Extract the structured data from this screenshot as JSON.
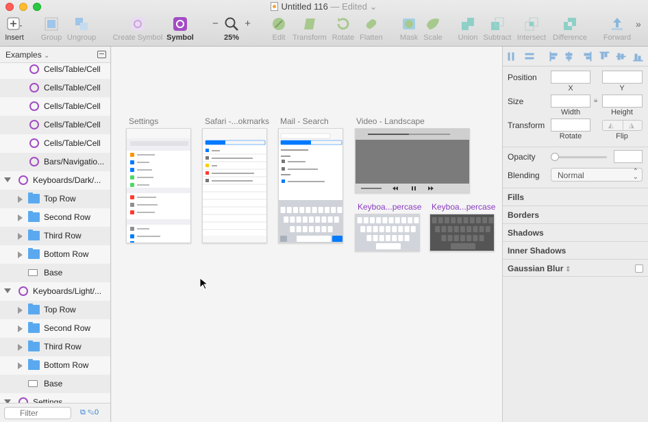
{
  "window": {
    "title": "Untitled 116",
    "status": "Edited"
  },
  "toolbar": [
    {
      "id": "insert",
      "label": "Insert",
      "icon": "plus-icon",
      "enabled": true
    },
    {
      "id": "group",
      "label": "Group",
      "icon": "group-icon",
      "enabled": false
    },
    {
      "id": "ungroup",
      "label": "Ungroup",
      "icon": "ungroup-icon",
      "enabled": false
    },
    {
      "id": "create-symbol",
      "label": "Create Symbol",
      "icon": "create-symbol-icon",
      "enabled": false
    },
    {
      "id": "symbol",
      "label": "Symbol",
      "icon": "symbol-icon",
      "enabled": true
    },
    {
      "id": "zoom",
      "label": "25%",
      "icon": "magnifier-icon",
      "enabled": true
    },
    {
      "id": "edit",
      "label": "Edit",
      "icon": "edit-icon",
      "enabled": false
    },
    {
      "id": "transform",
      "label": "Transform",
      "icon": "transform-icon",
      "enabled": false
    },
    {
      "id": "rotate",
      "label": "Rotate",
      "icon": "rotate-icon",
      "enabled": false
    },
    {
      "id": "flatten",
      "label": "Flatten",
      "icon": "flatten-icon",
      "enabled": false
    },
    {
      "id": "mask",
      "label": "Mask",
      "icon": "mask-icon",
      "enabled": false
    },
    {
      "id": "scale",
      "label": "Scale",
      "icon": "scale-icon",
      "enabled": false
    },
    {
      "id": "union",
      "label": "Union",
      "icon": "union-icon",
      "enabled": false
    },
    {
      "id": "subtract",
      "label": "Subtract",
      "icon": "subtract-icon",
      "enabled": false
    },
    {
      "id": "intersect",
      "label": "Intersect",
      "icon": "intersect-icon",
      "enabled": false
    },
    {
      "id": "difference",
      "label": "Difference",
      "icon": "difference-icon",
      "enabled": false
    },
    {
      "id": "forward",
      "label": "Forward",
      "icon": "forward-icon",
      "enabled": false
    }
  ],
  "sidebar": {
    "page": "Examples",
    "layers": [
      {
        "name": "Cells/Table/Cell",
        "type": "symbol",
        "indent": 1
      },
      {
        "name": "Cells/Table/Cell",
        "type": "symbol",
        "indent": 1
      },
      {
        "name": "Cells/Table/Cell",
        "type": "symbol",
        "indent": 1
      },
      {
        "name": "Cells/Table/Cell",
        "type": "symbol",
        "indent": 1
      },
      {
        "name": "Cells/Table/Cell",
        "type": "symbol",
        "indent": 1
      },
      {
        "name": "Bars/Navigatio...",
        "type": "symbol",
        "indent": 1
      },
      {
        "name": "Keyboards/Dark/...",
        "type": "symbol",
        "indent": 0,
        "expanded": true
      },
      {
        "name": "Top Row",
        "type": "folder",
        "indent": 1
      },
      {
        "name": "Second Row",
        "type": "folder",
        "indent": 1
      },
      {
        "name": "Third Row",
        "type": "folder",
        "indent": 1
      },
      {
        "name": "Bottom Row",
        "type": "folder",
        "indent": 1
      },
      {
        "name": "Base",
        "type": "rect",
        "indent": 1
      },
      {
        "name": "Keyboards/Light/...",
        "type": "symbol",
        "indent": 0,
        "expanded": true
      },
      {
        "name": "Top Row",
        "type": "folder",
        "indent": 1
      },
      {
        "name": "Second Row",
        "type": "folder",
        "indent": 1
      },
      {
        "name": "Third Row",
        "type": "folder",
        "indent": 1
      },
      {
        "name": "Bottom Row",
        "type": "folder",
        "indent": 1
      },
      {
        "name": "Base",
        "type": "rect",
        "indent": 1
      },
      {
        "name": "Settings",
        "type": "symbol",
        "indent": 0,
        "expanded": true
      }
    ],
    "filter_placeholder": "Filter",
    "footer_count": "0"
  },
  "canvas": {
    "artboards": [
      {
        "id": "settings",
        "title": "Settings",
        "symbol": false
      },
      {
        "id": "safari",
        "title": "Safari -...okmarks",
        "symbol": false
      },
      {
        "id": "mail",
        "title": "Mail - Search",
        "symbol": false
      },
      {
        "id": "video",
        "title": "Video - Landscape",
        "symbol": false
      },
      {
        "id": "kb-light",
        "title": "Keyboa...percase",
        "symbol": true
      },
      {
        "id": "kb-dark",
        "title": "Keyboa...percase",
        "symbol": true
      }
    ]
  },
  "inspector": {
    "position": "Position",
    "x_label": "X",
    "y_label": "Y",
    "size": "Size",
    "width_label": "Width",
    "height_label": "Height",
    "transform": "Transform",
    "rotate_label": "Rotate",
    "flip_label": "Flip",
    "opacity": "Opacity",
    "blending": "Blending",
    "blending_value": "Normal",
    "sections": [
      "Fills",
      "Borders",
      "Shadows",
      "Inner Shadows",
      "Gaussian Blur"
    ]
  },
  "colors": {
    "symbol_purple": "#a24cc3",
    "folder_blue": "#5aa9f0",
    "accent_blue": "#2f7fd8"
  }
}
